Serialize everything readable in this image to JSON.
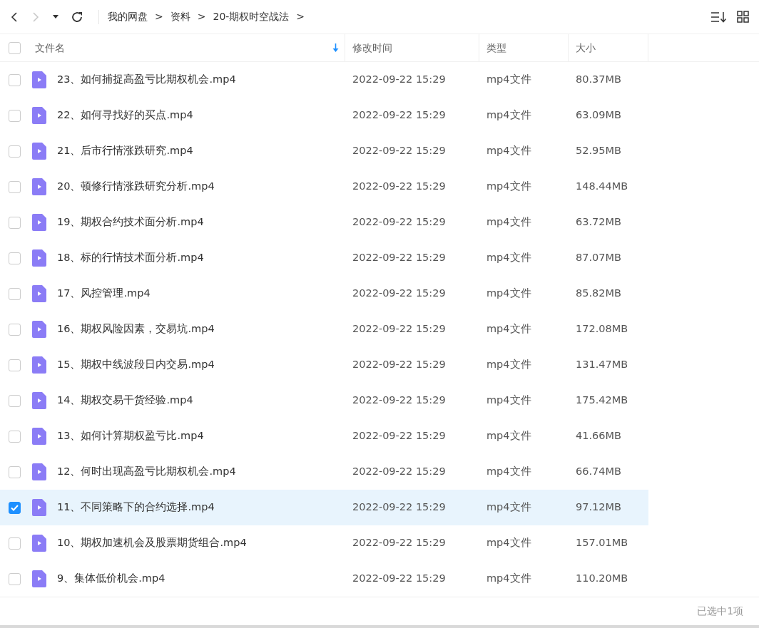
{
  "toolbar": {
    "nav": [
      {
        "kind": "back",
        "disabled": false
      },
      {
        "kind": "forward",
        "disabled": true
      },
      {
        "kind": "history",
        "disabled": false
      },
      {
        "kind": "refresh",
        "disabled": false
      }
    ],
    "breadcrumb": [
      {
        "label": "我的网盘",
        "separator": ">"
      },
      {
        "label": "资料",
        "separator": ">"
      },
      {
        "label": "20-期权时空战法",
        "separator": ">"
      }
    ]
  },
  "table": {
    "select_all": {
      "checked": false
    },
    "columns": [
      {
        "label": "文件名",
        "sorted": true
      },
      {
        "label": "修改时间",
        "sorted": false
      },
      {
        "label": "类型",
        "sorted": false
      },
      {
        "label": "大小",
        "sorted": false
      }
    ],
    "rows": [
      {
        "name": "23、如何捕捉高盈亏比期权机会.mp4",
        "modified": "2022-09-22 15:29",
        "type": "mp4文件",
        "size": "80.37MB",
        "selected": false
      },
      {
        "name": "22、如何寻找好的买点.mp4",
        "modified": "2022-09-22 15:29",
        "type": "mp4文件",
        "size": "63.09MB",
        "selected": false
      },
      {
        "name": "21、后市行情涨跌研究.mp4",
        "modified": "2022-09-22 15:29",
        "type": "mp4文件",
        "size": "52.95MB",
        "selected": false
      },
      {
        "name": "20、顿修行情涨跌研究分析.mp4",
        "modified": "2022-09-22 15:29",
        "type": "mp4文件",
        "size": "148.44MB",
        "selected": false
      },
      {
        "name": "19、期权合约技术面分析.mp4",
        "modified": "2022-09-22 15:29",
        "type": "mp4文件",
        "size": "63.72MB",
        "selected": false
      },
      {
        "name": "18、标的行情技术面分析.mp4",
        "modified": "2022-09-22 15:29",
        "type": "mp4文件",
        "size": "87.07MB",
        "selected": false
      },
      {
        "name": "17、风控管理.mp4",
        "modified": "2022-09-22 15:29",
        "type": "mp4文件",
        "size": "85.82MB",
        "selected": false
      },
      {
        "name": "16、期权风险因素，交易坑.mp4",
        "modified": "2022-09-22 15:29",
        "type": "mp4文件",
        "size": "172.08MB",
        "selected": false
      },
      {
        "name": "15、期权中线波段日内交易.mp4",
        "modified": "2022-09-22 15:29",
        "type": "mp4文件",
        "size": "131.47MB",
        "selected": false
      },
      {
        "name": "14、期权交易干货经验.mp4",
        "modified": "2022-09-22 15:29",
        "type": "mp4文件",
        "size": "175.42MB",
        "selected": false
      },
      {
        "name": "13、如何计算期权盈亏比.mp4",
        "modified": "2022-09-22 15:29",
        "type": "mp4文件",
        "size": "41.66MB",
        "selected": false
      },
      {
        "name": "12、何时出现高盈亏比期权机会.mp4",
        "modified": "2022-09-22 15:29",
        "type": "mp4文件",
        "size": "66.74MB",
        "selected": false
      },
      {
        "name": "11、不同策略下的合约选择.mp4",
        "modified": "2022-09-22 15:29",
        "type": "mp4文件",
        "size": "97.12MB",
        "selected": true
      },
      {
        "name": "10、期权加速机会及股票期货组合.mp4",
        "modified": "2022-09-22 15:29",
        "type": "mp4文件",
        "size": "157.01MB",
        "selected": false
      },
      {
        "name": "9、集体低价机会.mp4",
        "modified": "2022-09-22 15:29",
        "type": "mp4文件",
        "size": "110.20MB",
        "selected": false
      }
    ]
  },
  "status_bar": {
    "text": "已选中1项"
  }
}
